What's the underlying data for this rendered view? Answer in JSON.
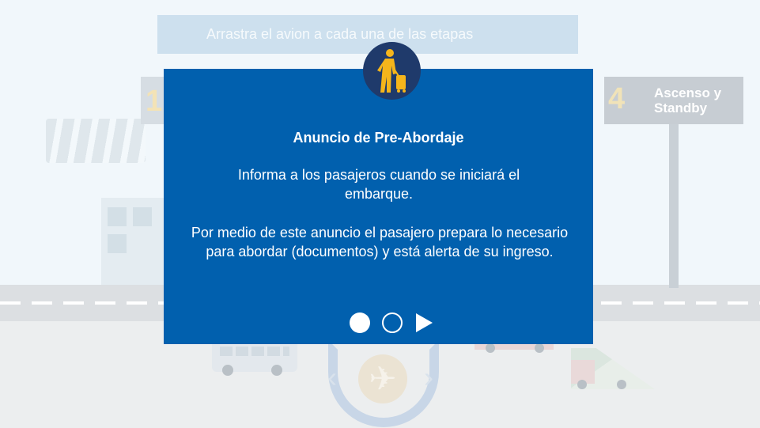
{
  "instruction": "Arrastra el avion a cada una de las etapas",
  "steps": {
    "left": {
      "number": "1"
    },
    "right": {
      "number": "4",
      "title": "Ascenso y Standby"
    }
  },
  "modal": {
    "avatar_icon": "traveler-with-luggage-icon",
    "title": "Anuncio de Pre-Abordaje",
    "paragraph_1": "Informa a los pasajeros cuando se iniciará el embarque.",
    "paragraph_2": "Por medio de este anuncio el pasajero prepara lo necesario para abordar (documentos) y está alerta de su ingreso.",
    "pagination": {
      "current": 1,
      "total": 2
    }
  },
  "controls": {
    "left_icon": "chevron-left-icon",
    "center_icon": "airplane-icon",
    "right_icon": "chevron-right-icon"
  },
  "colors": {
    "modal_bg": "#0160AE",
    "avatar_bg": "#1F3A6B",
    "avatar_figure": "#F5B51B",
    "instruction_bg": "#CDE0EE"
  }
}
